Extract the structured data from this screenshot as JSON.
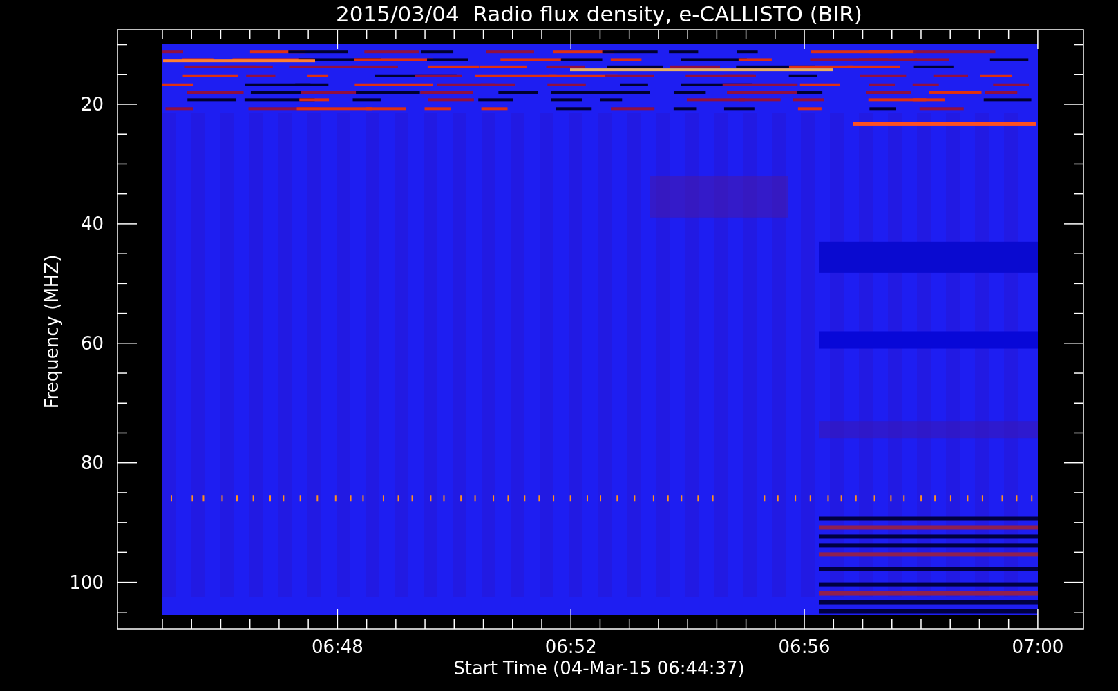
{
  "title": "2015/03/04  Radio flux density, e-CALLISTO (BIR)",
  "y_axis": {
    "label": "Frequency (MHZ)",
    "ticks": [
      "20",
      "40",
      "60",
      "80",
      "100"
    ]
  },
  "x_axis": {
    "label": "Start Time (04-Mar-15 06:44:37)",
    "ticks": [
      "06:48",
      "06:52",
      "06:56",
      "07:00"
    ]
  }
}
